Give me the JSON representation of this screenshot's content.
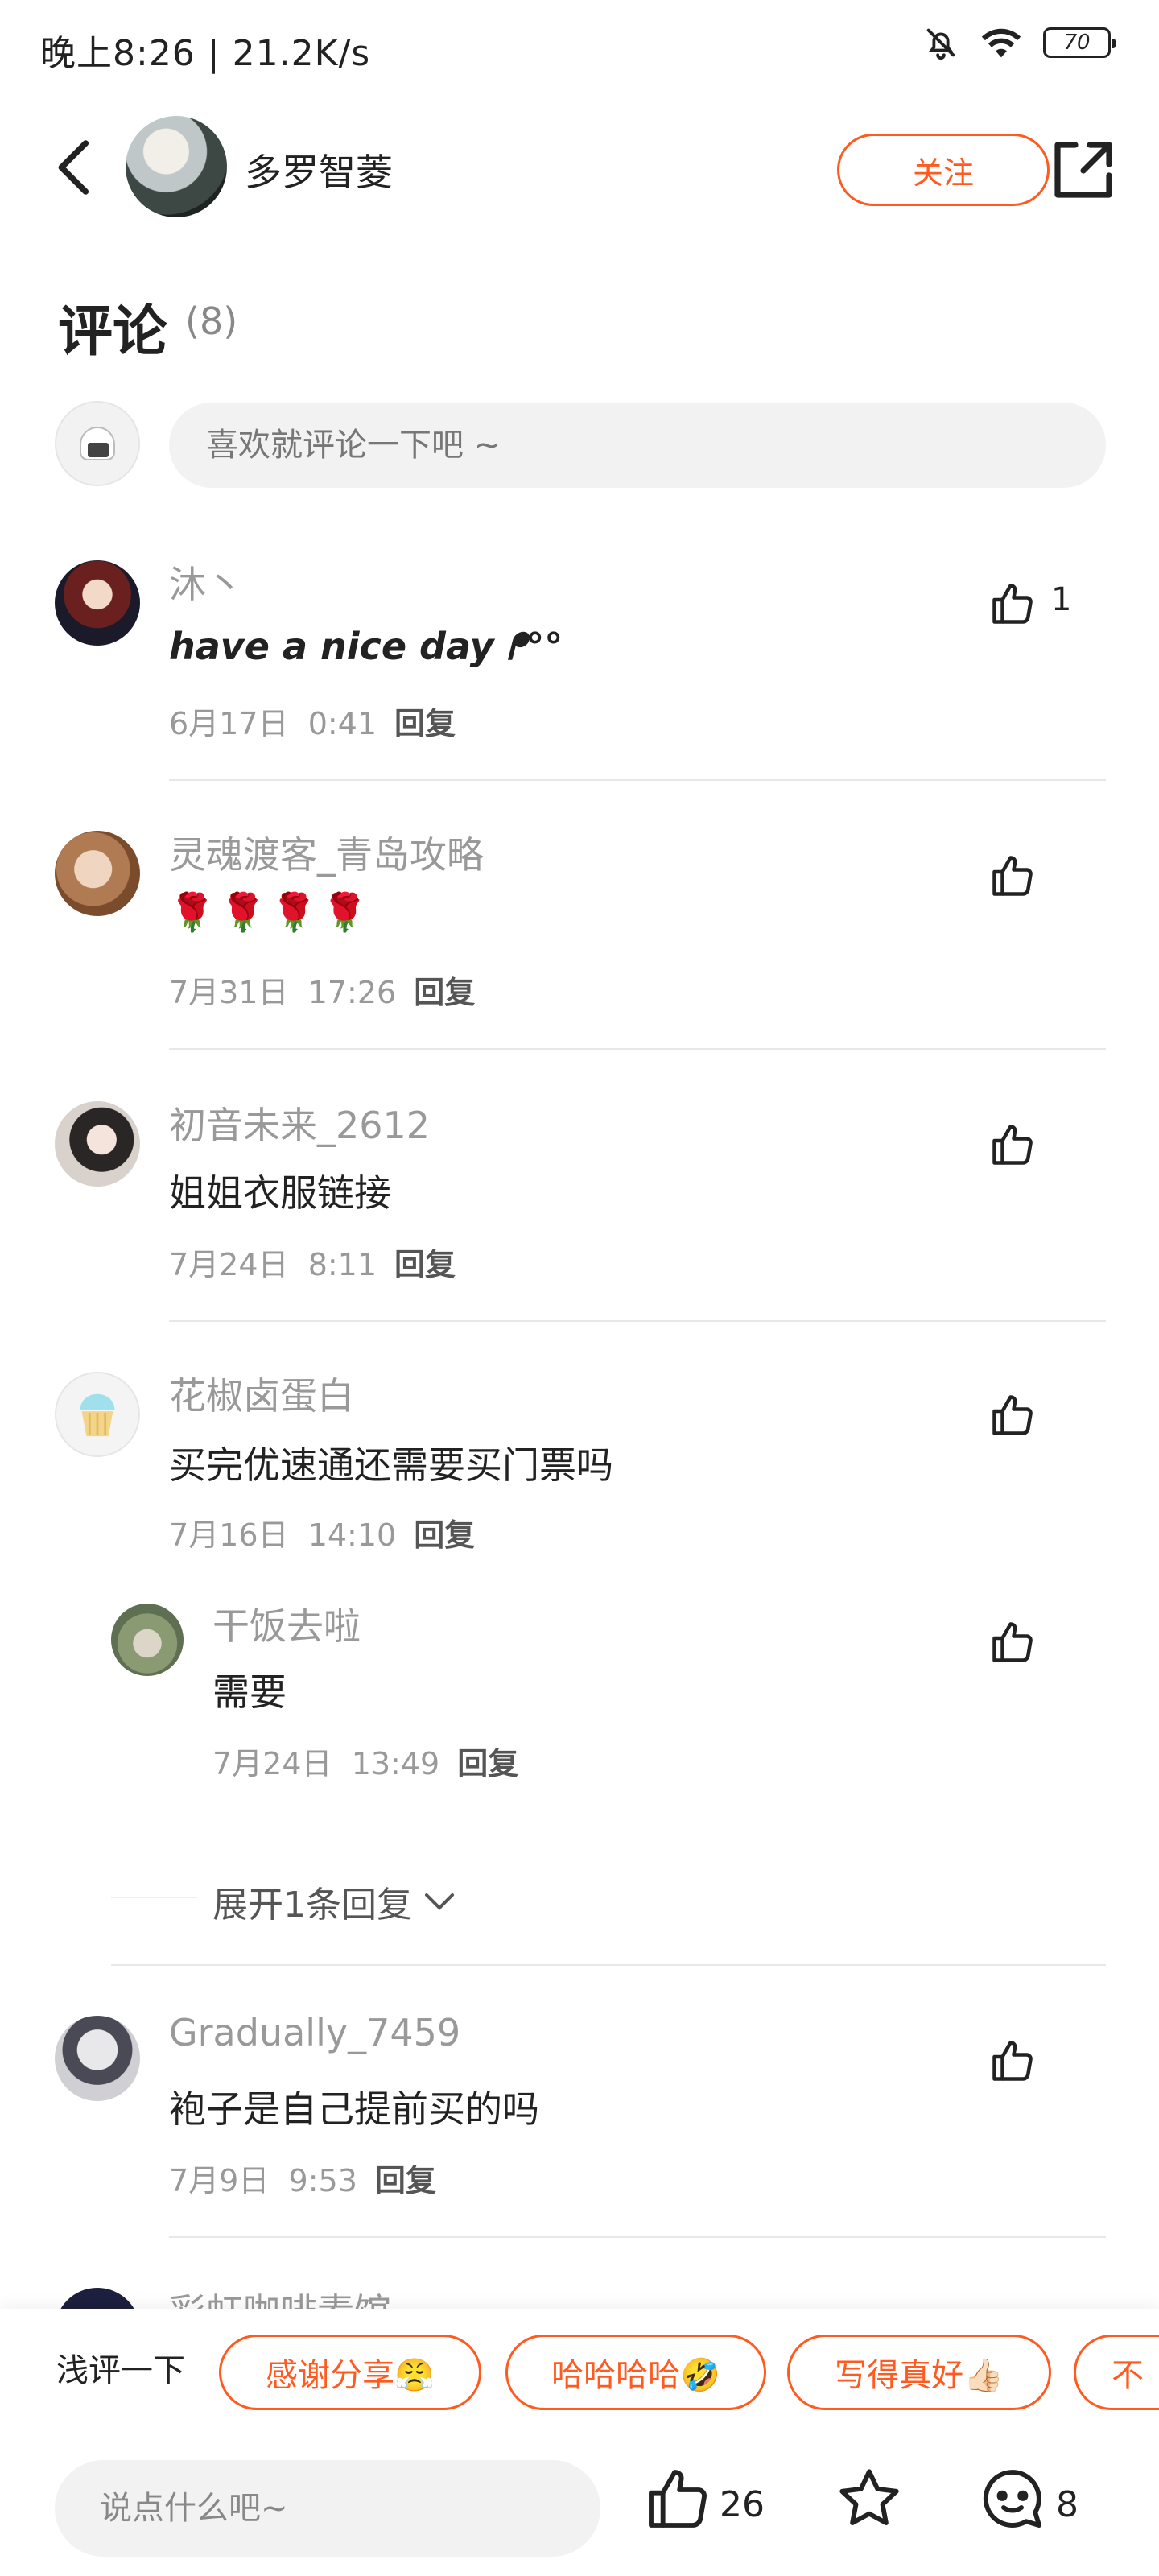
{
  "status_bar": {
    "time": "晚上8:26 | 21.2K/s",
    "battery": "70"
  },
  "header": {
    "author": "多罗智菱",
    "follow_label": "关注"
  },
  "comments_section": {
    "title": "评论",
    "count": "(8)",
    "input_placeholder": "喜欢就评论一下吧 ~"
  },
  "comments": [
    {
      "name": "沐丶",
      "text": "have a nice day ᖰ°°",
      "date": "6月17日",
      "time": "0:41",
      "reply": "回复",
      "likes": "1"
    },
    {
      "name": "灵魂渡客_青岛攻略",
      "text": "🌹🌹🌹🌹",
      "date": "7月31日",
      "time": "17:26",
      "reply": "回复",
      "likes": ""
    },
    {
      "name": "初音未来_2612",
      "text": "姐姐衣服链接",
      "date": "7月24日",
      "time": "8:11",
      "reply": "回复",
      "likes": ""
    },
    {
      "name": "花椒卤蛋白",
      "text": "买完优速通还需要买门票吗",
      "date": "7月16日",
      "time": "14:10",
      "reply": "回复",
      "likes": ""
    },
    {
      "name": "干饭去啦",
      "text": "需要",
      "date": "7月24日",
      "time": "13:49",
      "reply": "回复",
      "likes": ""
    },
    {
      "name": "Gradually_7459",
      "text": "袍子是自己提前买的吗",
      "date": "7月9日",
      "time": "9:53",
      "reply": "回复",
      "likes": ""
    }
  ],
  "partial_next": {
    "name": "彩虹咖啡素馆"
  },
  "expand_replies": "展开1条回复",
  "quick_comment": {
    "label": "浅评一下",
    "chips": [
      "感谢分享😤",
      "哈哈哈哈🤣",
      "写得真好👍🏻",
      "不"
    ]
  },
  "bottom_bar": {
    "say_placeholder": "说点什么吧~",
    "likes": "26",
    "comments": "8"
  },
  "colors": {
    "accent": "#ff5a1f",
    "muted_text": "#999999",
    "input_bg": "#f2f2f2"
  }
}
